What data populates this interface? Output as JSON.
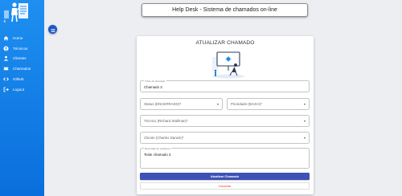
{
  "header": {
    "title": "Help Desk - Sistema de chamados on-line"
  },
  "sidebar": {
    "items": [
      {
        "label": "Home",
        "icon": "home-icon"
      },
      {
        "label": "Técnicos",
        "icon": "user-badge-icon"
      },
      {
        "label": "Clientes",
        "icon": "person-icon"
      },
      {
        "label": "Chamados",
        "icon": "ticket-icon"
      },
      {
        "label": "Github",
        "icon": "code-icon"
      },
      {
        "label": "Logout",
        "icon": "logout-icon"
      }
    ]
  },
  "card": {
    "title": "ATUALIZAR CHAMADO",
    "fields": {
      "titulo": {
        "label": "Título do chamado",
        "value": "Chamado 3"
      },
      "status": {
        "placeholder": "Status (ENCERRADO)*"
      },
      "prioridade": {
        "placeholder": "Prioridade (BAIXA)*"
      },
      "tecnico": {
        "placeholder": "Técnico (Richard Stallman)*"
      },
      "cliente": {
        "placeholder": "Cliente (Charles Darwin)*"
      },
      "descricao": {
        "label": "Descrição do problema",
        "value": "Teste chamado 3"
      }
    },
    "buttons": {
      "update": "Atualizar Chamado",
      "cancel": "Cancelar"
    }
  },
  "colors": {
    "sidebar": "#1e8ff0",
    "fab": "#1f57c6",
    "primary_button": "#3f51b5",
    "cancel_text": "#e53935",
    "background": "#eceef1"
  }
}
